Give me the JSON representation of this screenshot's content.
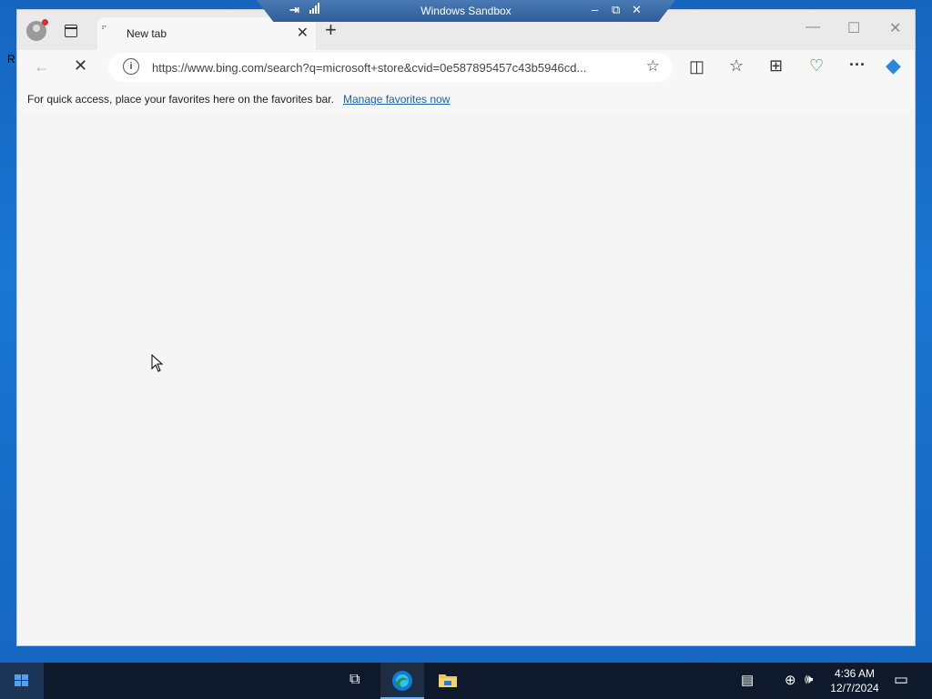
{
  "desktop": {
    "edge_text": "R"
  },
  "sandbox_bar": {
    "title": "Windows Sandbox",
    "pin_icon": "⇥",
    "minimize_icon": "–",
    "restore_icon": "⧉",
    "close_icon": "✕"
  },
  "browser": {
    "tab": {
      "label": "New tab",
      "close_icon": "✕",
      "loading_icon": "⠋"
    },
    "new_tab_icon": "+",
    "window_controls": {
      "minimize": "—",
      "maximize": "☐",
      "close": "✕"
    },
    "toolbar": {
      "back_icon": "←",
      "stop_icon": "✕",
      "url": "https://www.bing.com/search?q=microsoft+store&cvid=0e587895457c43b5946cd...",
      "info_icon": "i",
      "favorite_icon": "☆",
      "split_screen_icon": "◫",
      "favorites_icon": "☆",
      "collections_icon": "⊞",
      "performance_icon": "♡",
      "more_icon": "···",
      "copilot_icon": "◆"
    },
    "favorites_bar": {
      "message": "For quick access, place your favorites here on the favorites bar.",
      "link": "Manage favorites now"
    }
  },
  "taskbar": {
    "task_view_icon": "⧉",
    "time": "4:36 AM",
    "date": "12/7/2024",
    "news_icon": "▤",
    "network_icon": "⊕",
    "volume_icon": "🕪",
    "notification_icon": "▭"
  },
  "colors": {
    "desktop_blue": "#1565c0",
    "taskbar": "#0e1a2b",
    "link": "#1a5fb4",
    "copilot_accent": "#2b88d8"
  }
}
